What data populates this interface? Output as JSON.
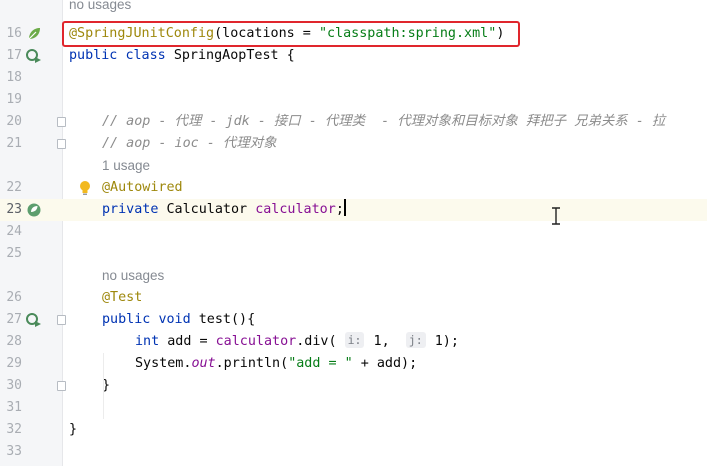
{
  "editor": {
    "lines": [
      {
        "num": "",
        "hint": "no usages"
      },
      {
        "num": "16",
        "annotation": "@SpringJUnitConfig",
        "paren_open": "(locations = ",
        "string": "\"classpath:spring.xml\"",
        "paren_close": ")"
      },
      {
        "num": "17",
        "kw1": "public",
        "kw2": "class",
        "name": "SpringAopTest {"
      },
      {
        "num": "18"
      },
      {
        "num": "19"
      },
      {
        "num": "20",
        "comment": "// aop - 代理 - jdk - 接口 - 代理类  - 代理对象和目标对象 拜把子 兄弟关系 - 拉"
      },
      {
        "num": "21",
        "comment": "// aop - ioc - 代理对象"
      },
      {
        "num": "",
        "hint": "1 usage"
      },
      {
        "num": "22",
        "annotation": "@Autowired"
      },
      {
        "num": "23",
        "kw": "private",
        "type": "Calculator",
        "field": "calculator",
        "end": ";"
      },
      {
        "num": "24"
      },
      {
        "num": "25"
      },
      {
        "num": "",
        "hint": "no usages"
      },
      {
        "num": "26",
        "annotation": "@Test"
      },
      {
        "num": "27",
        "kw1": "public",
        "kw2": "void",
        "name": "test(){"
      },
      {
        "num": "28",
        "kw": "int",
        "pre": " add = ",
        "field": "calculator",
        "call": ".div( ",
        "hint_i": "i:",
        "arg1": " 1,  ",
        "hint_j": "j:",
        "arg2": " 1);"
      },
      {
        "num": "29",
        "sys": "System.",
        "out": "out",
        "rest": ".println(",
        "string": "\"add = \"",
        "tail": " + add);"
      },
      {
        "num": "30",
        "brace": "}"
      },
      {
        "num": "31"
      },
      {
        "num": "32",
        "brace": "}"
      },
      {
        "num": "33"
      }
    ]
  },
  "icons": {
    "line16": "spring-bean-leaf-icon",
    "line17": "run-test-class-icon",
    "line22": "intention-bulb-icon",
    "line23": "spring-autowired-bean-icon",
    "line27": "run-test-method-icon"
  },
  "colors": {
    "highlight_box": "#e0262d",
    "annotation": "#9e880d",
    "keyword": "#0033b3",
    "string": "#067d17",
    "field": "#871094",
    "comment": "#8c8c8c"
  }
}
